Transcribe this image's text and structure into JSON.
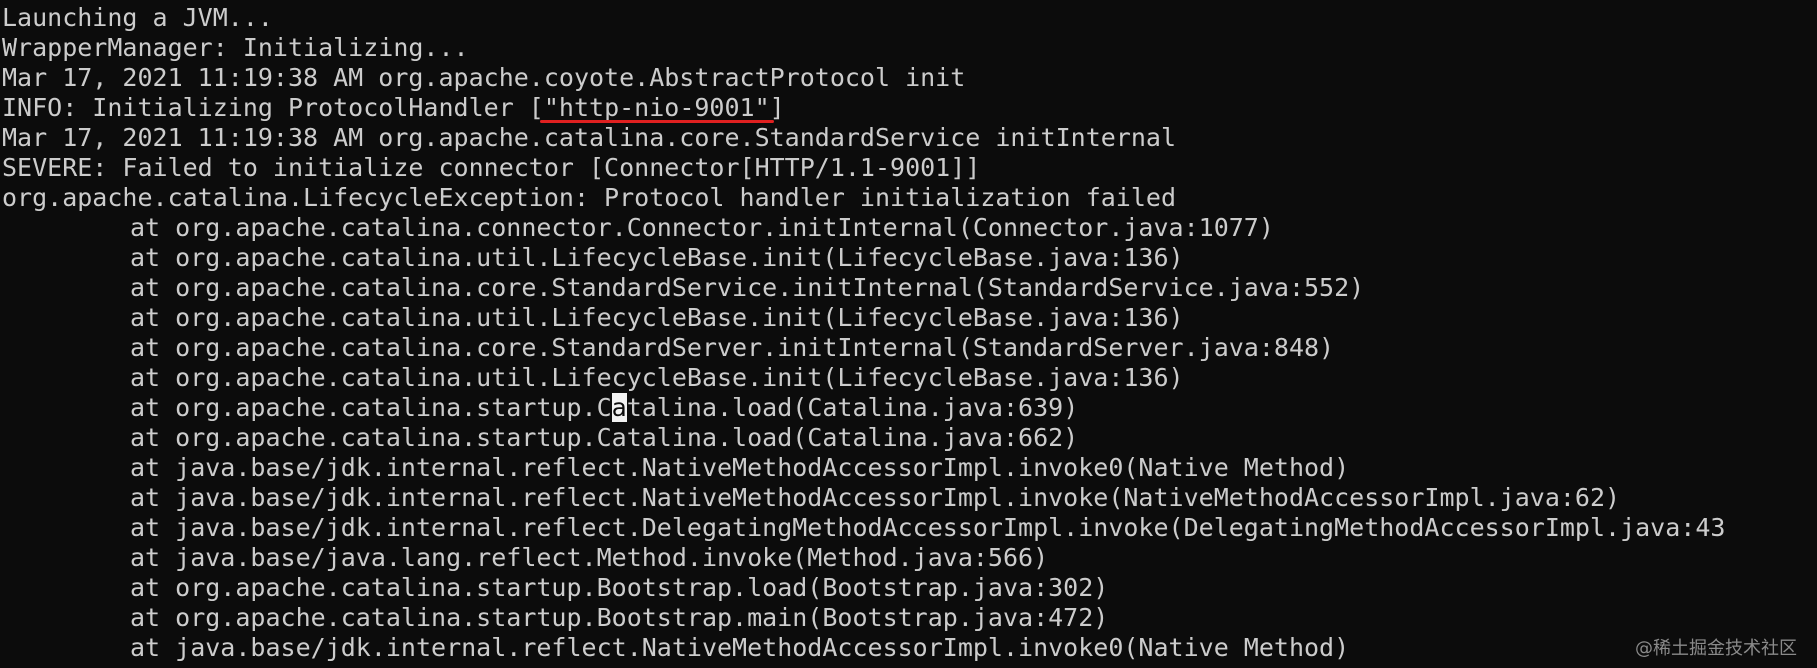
{
  "terminal": {
    "lines": [
      "Launching a JVM...",
      "WrapperManager: Initializing...",
      "Mar 17, 2021 11:19:38 AM org.apache.coyote.AbstractProtocol init"
    ],
    "info_prefix": "INFO: Initializing ProtocolHandler [",
    "info_highlight": "\"http-nio-9001\"",
    "info_suffix": "]",
    "lines_after_info": [
      "Mar 17, 2021 11:19:38 AM org.apache.catalina.core.StandardService initInternal",
      "SEVERE: Failed to initialize connector [Connector[HTTP/1.1-9001]]",
      "org.apache.catalina.LifecycleException: Protocol handler initialization failed"
    ],
    "stack_before_cursor": [
      "at org.apache.catalina.connector.Connector.initInternal(Connector.java:1077)",
      "at org.apache.catalina.util.LifecycleBase.init(LifecycleBase.java:136)",
      "at org.apache.catalina.core.StandardService.initInternal(StandardService.java:552)",
      "at org.apache.catalina.util.LifecycleBase.init(LifecycleBase.java:136)",
      "at org.apache.catalina.core.StandardServer.initInternal(StandardServer.java:848)",
      "at org.apache.catalina.util.LifecycleBase.init(LifecycleBase.java:136)"
    ],
    "cursor_line_prefix": "at org.apache.catalina.startup.C",
    "cursor_char": "a",
    "cursor_line_suffix": "talina.load(Catalina.java:639)",
    "stack_after_cursor": [
      "at org.apache.catalina.startup.Catalina.load(Catalina.java:662)",
      "at java.base/jdk.internal.reflect.NativeMethodAccessorImpl.invoke0(Native Method)",
      "at java.base/jdk.internal.reflect.NativeMethodAccessorImpl.invoke(NativeMethodAccessorImpl.java:62)",
      "at java.base/jdk.internal.reflect.DelegatingMethodAccessorImpl.invoke(DelegatingMethodAccessorImpl.java:43",
      "at java.base/java.lang.reflect.Method.invoke(Method.java:566)",
      "at org.apache.catalina.startup.Bootstrap.load(Bootstrap.java:302)",
      "at org.apache.catalina.startup.Bootstrap.main(Bootstrap.java:472)",
      "at java.base/jdk.internal.reflect.NativeMethodAccessorImpl.invoke0(Native Method)"
    ]
  },
  "watermark": "@稀土掘金技术社区",
  "colors": {
    "background": "#0c0c0c",
    "text": "#cccccc",
    "underline": "#e02020"
  }
}
